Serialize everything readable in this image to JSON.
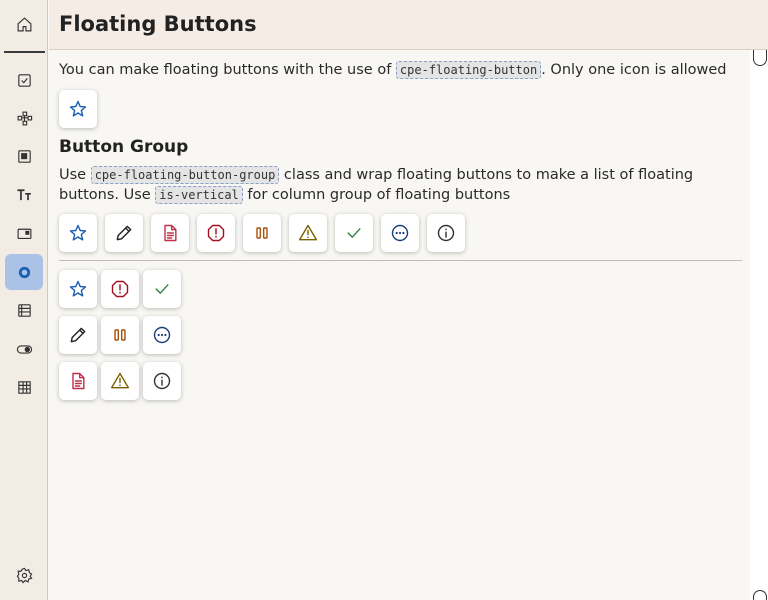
{
  "header": {
    "title": "Floating Buttons"
  },
  "sidebar": {
    "items": [
      {
        "name": "home"
      },
      {
        "name": "checkbox"
      },
      {
        "name": "diagram"
      },
      {
        "name": "panel"
      },
      {
        "name": "typography"
      },
      {
        "name": "card"
      },
      {
        "name": "floating-buttons",
        "active": true
      },
      {
        "name": "list"
      },
      {
        "name": "toggle"
      },
      {
        "name": "table"
      },
      {
        "name": "settings"
      }
    ]
  },
  "intro": {
    "text_before": "You can make floating buttons with the use of ",
    "code": "cpe-floating-button",
    "text_after": ". Only one icon is allowed"
  },
  "group_section": {
    "title": "Button Group",
    "text1": "Use ",
    "code1": "cpe-floating-button-group",
    "text2": " class and wrap floating buttons to make a list of floating buttons. Use ",
    "code2": "is-vertical",
    "text3": " for column group of floating buttons"
  },
  "colors": {
    "star": "#1a5fb4",
    "pencil": "#222222",
    "document": "#c0304a",
    "stop": "#a01020",
    "pause": "#a5520a",
    "warning": "#7a6100",
    "check": "#2e8540",
    "more": "#1c3f7a",
    "info": "#333333"
  }
}
